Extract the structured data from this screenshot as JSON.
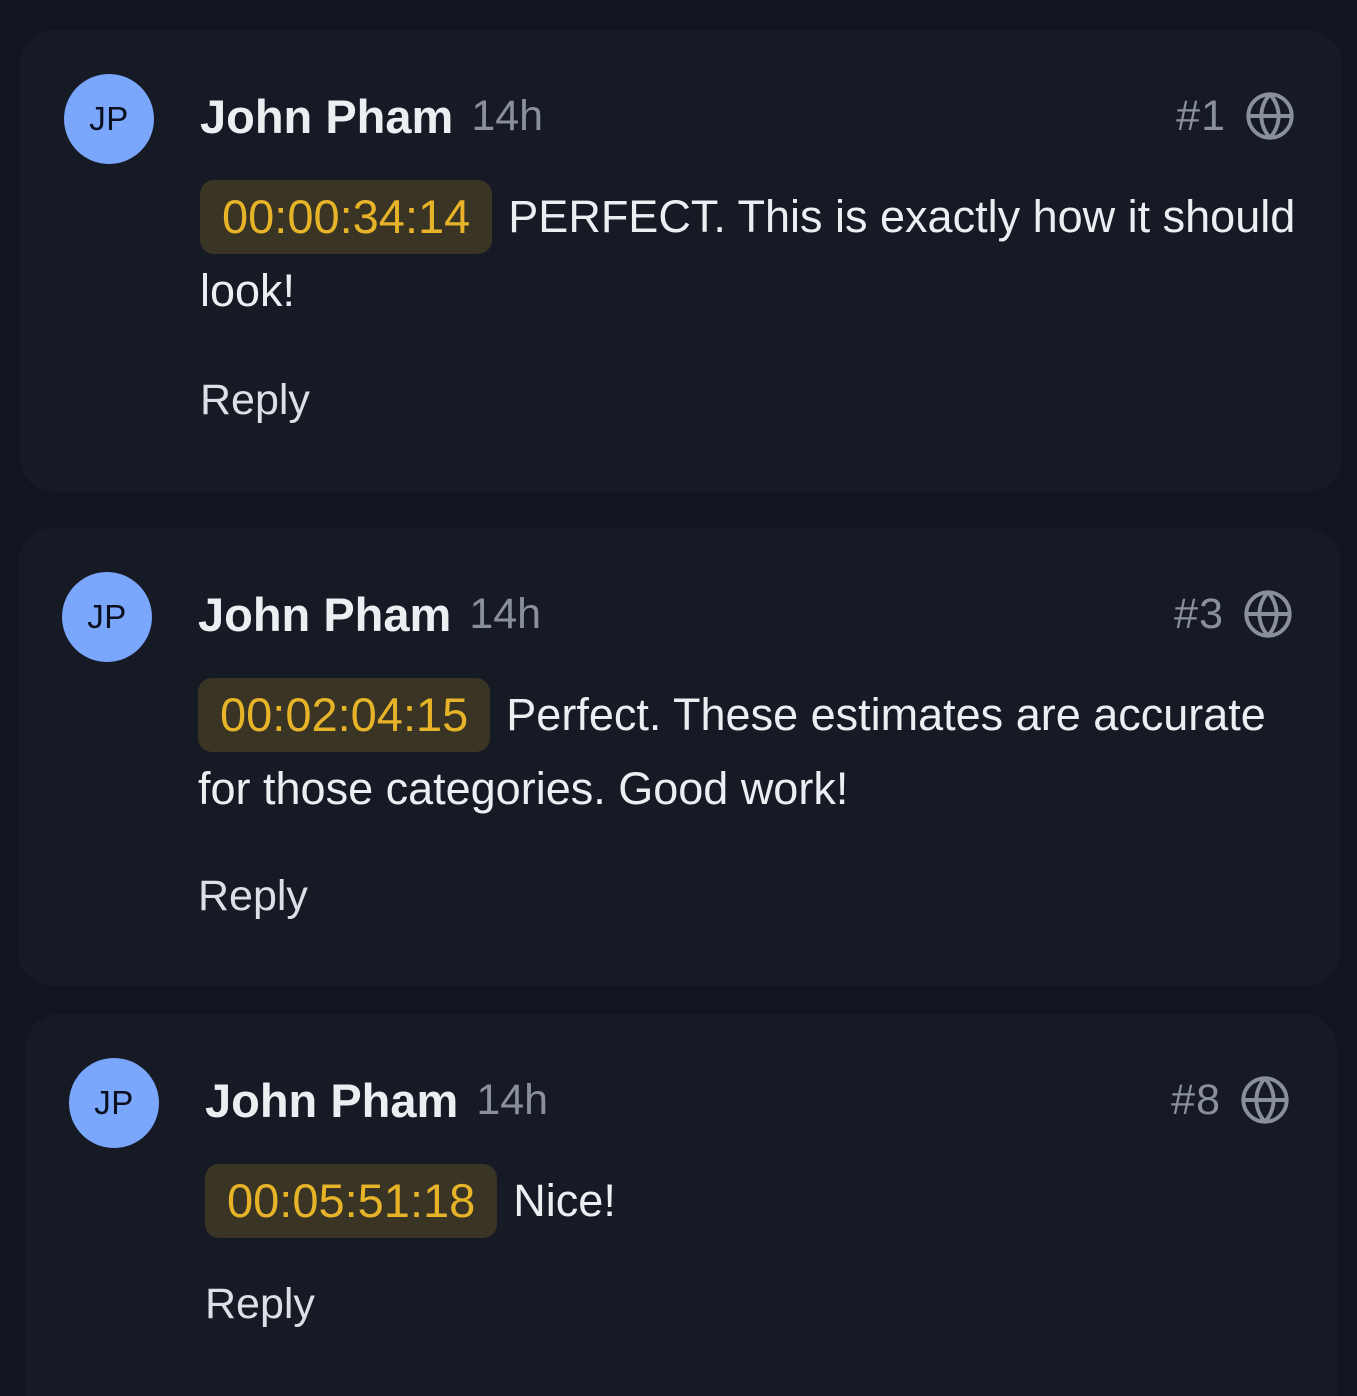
{
  "comments": [
    {
      "avatar_initials": "JP",
      "author": "John Pham",
      "time": "14h",
      "number": "#1",
      "timecode": "00:00:34:14",
      "text": "PERFECT. This is exactly how it should look!",
      "reply_label": "Reply"
    },
    {
      "avatar_initials": "JP",
      "author": "John Pham",
      "time": "14h",
      "number": "#3",
      "timecode": "00:02:04:15",
      "text": "Perfect. These estimates are accurate for those categories. Good work!",
      "reply_label": "Reply"
    },
    {
      "avatar_initials": "JP",
      "author": "John Pham",
      "time": "14h",
      "number": "#8",
      "timecode": "00:05:51:18",
      "text": "Nice!",
      "reply_label": "Reply"
    }
  ],
  "icons": {
    "visibility": "globe-icon"
  },
  "colors": {
    "background": "#121520",
    "card": "#161a25",
    "avatar": "#7aa6fb",
    "timecode_bg": "#3a3424",
    "timecode_text": "#e7b328",
    "text_primary": "#eceef2",
    "text_muted": "#8a8f9c"
  }
}
